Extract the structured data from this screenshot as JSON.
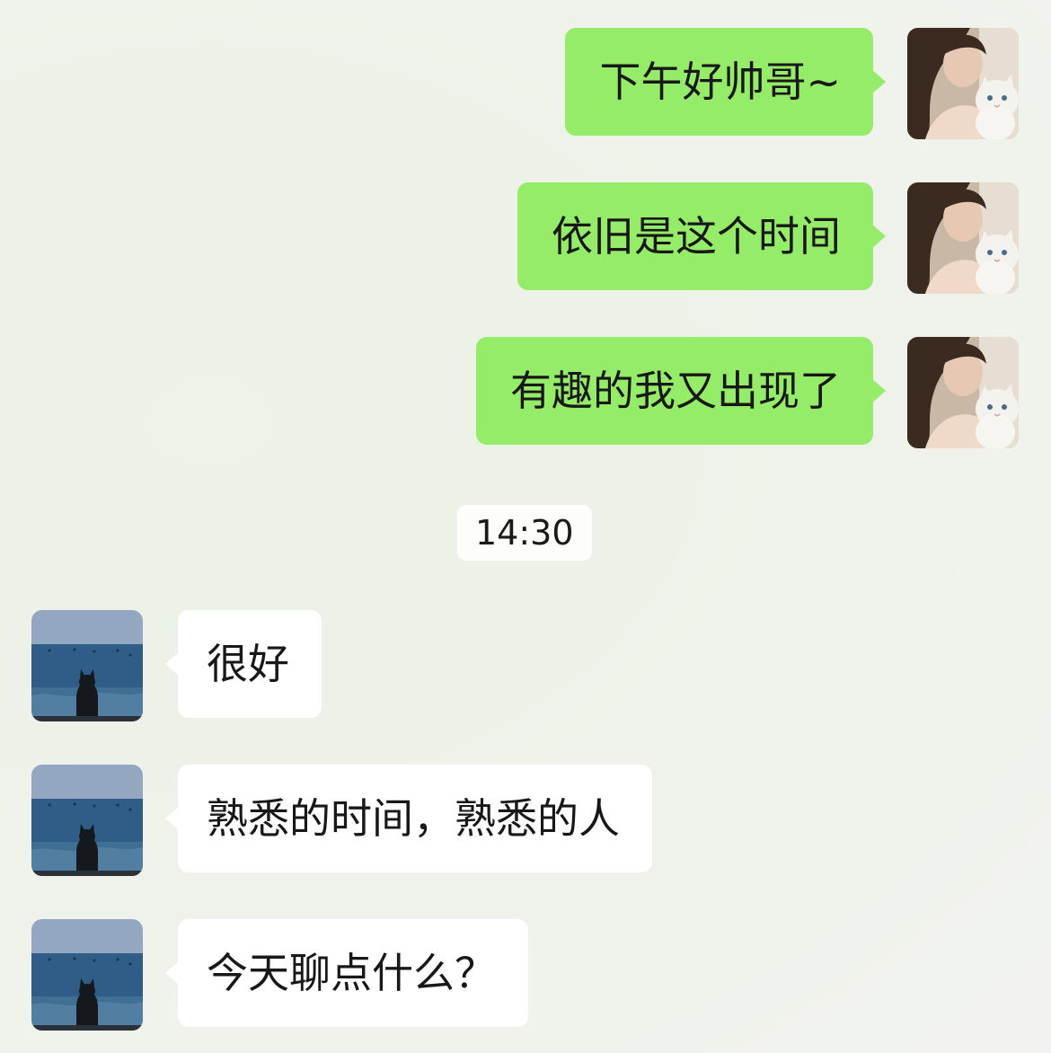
{
  "messages": [
    {
      "sender": "self",
      "text": "下午好帅哥~"
    },
    {
      "sender": "self",
      "text": "依旧是这个时间"
    },
    {
      "sender": "self",
      "text": "有趣的我又出现了"
    },
    {
      "sender": "other",
      "text": "很好"
    },
    {
      "sender": "other",
      "text": "熟悉的时间，熟悉的人"
    },
    {
      "sender": "other",
      "text": "今天聊点什么？"
    }
  ],
  "timestamp": "14:30",
  "colors": {
    "self_bubble": "#95ec69",
    "other_bubble": "#ffffff",
    "text": "#181818"
  },
  "avatars": {
    "self": "avatar-woman-with-white-cat",
    "other": "avatar-cat-looking-at-sea"
  }
}
